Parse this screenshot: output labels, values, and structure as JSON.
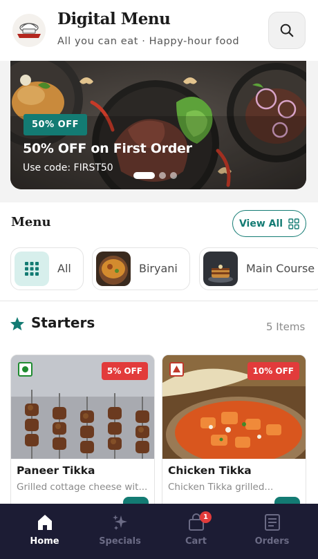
{
  "header": {
    "title": "Digital Menu",
    "subtitle": "All you can eat · Happy-hour food",
    "logo_text": "RESTAURANT",
    "search_icon": "search-icon"
  },
  "banner": {
    "badge": "50% OFF",
    "title": "50% OFF on First Order",
    "code_text": "Use code: FIRST50",
    "slides": 3,
    "active_slide": 1
  },
  "menu": {
    "title": "Menu",
    "view_all_label": "View All",
    "categories": [
      {
        "label": "All",
        "icon": "grid-icon"
      },
      {
        "label": "Biryani",
        "icon": "biryani-thumbnail"
      },
      {
        "label": "Main Course",
        "icon": "main-course-thumbnail"
      }
    ]
  },
  "starters": {
    "title": "Starters",
    "count": "5 Items",
    "items": [
      {
        "name": "Paneer Tikka",
        "description": "Grilled cottage cheese wit...",
        "discount": "5% OFF",
        "diet": "veg"
      },
      {
        "name": "Chicken Tikka",
        "description": "Chicken Tikka grilled...",
        "discount": "10% OFF",
        "diet": "non-veg"
      }
    ]
  },
  "bottom_nav": {
    "items": [
      {
        "label": "Home",
        "icon": "home-icon",
        "active": true
      },
      {
        "label": "Specials",
        "icon": "sparkles-icon",
        "active": false
      },
      {
        "label": "Cart",
        "icon": "bag-icon",
        "active": false,
        "badge": "1"
      },
      {
        "label": "Orders",
        "icon": "receipt-icon",
        "active": false
      }
    ]
  },
  "colors": {
    "accent": "#137b73",
    "discount": "#e23b3b",
    "nav_bg": "#1c1c34",
    "veg": "#1e8b2f",
    "non_veg": "#c0392b"
  }
}
